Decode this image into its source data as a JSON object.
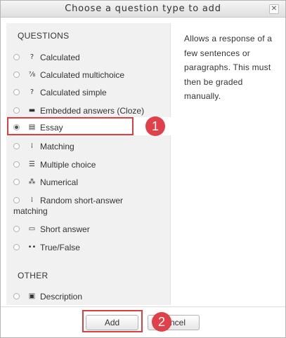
{
  "dialog": {
    "title": "Choose a question type to add",
    "close_glyph": "✕"
  },
  "sections": {
    "questions": "QUESTIONS",
    "other": "OTHER"
  },
  "options": {
    "calculated": {
      "label": "Calculated",
      "icon": "calculated-icon",
      "glyph": "?"
    },
    "calculated_multichoice": {
      "label": "Calculated multichoice",
      "icon": "calculated-multichoice-icon",
      "glyph": "⅞"
    },
    "calculated_simple": {
      "label": "Calculated simple",
      "icon": "calculated-simple-icon",
      "glyph": "?"
    },
    "cloze": {
      "label": "Embedded answers (Cloze)",
      "icon": "cloze-icon",
      "glyph": "▬"
    },
    "essay": {
      "label": "Essay",
      "icon": "essay-icon",
      "glyph": "▤",
      "selected": true
    },
    "matching": {
      "label": "Matching",
      "icon": "matching-icon",
      "glyph": "⁞"
    },
    "multichoice": {
      "label": "Multiple choice",
      "icon": "multiple-choice-icon",
      "glyph": "☰"
    },
    "numerical": {
      "label": "Numerical",
      "icon": "numerical-icon",
      "glyph": "⁂"
    },
    "random_short_answer": {
      "label_line1": "Random short-answer",
      "label_line2": "matching",
      "icon": "random-short-answer-icon",
      "glyph": "⁞"
    },
    "short_answer": {
      "label": "Short answer",
      "icon": "short-answer-icon",
      "glyph": "▭"
    },
    "truefalse": {
      "label": "True/False",
      "icon": "true-false-icon",
      "glyph": "••"
    },
    "description": {
      "label": "Description",
      "icon": "description-icon",
      "glyph": "▣"
    }
  },
  "description_text": "Allows a response of a few sentences or paragraphs. This must then be graded manually.",
  "buttons": {
    "add": "Add",
    "cancel_visible": "ncel"
  },
  "markers": {
    "one": "1",
    "two": "2"
  },
  "colors": {
    "highlight": "#d9403f",
    "marker": "#e0404a"
  }
}
